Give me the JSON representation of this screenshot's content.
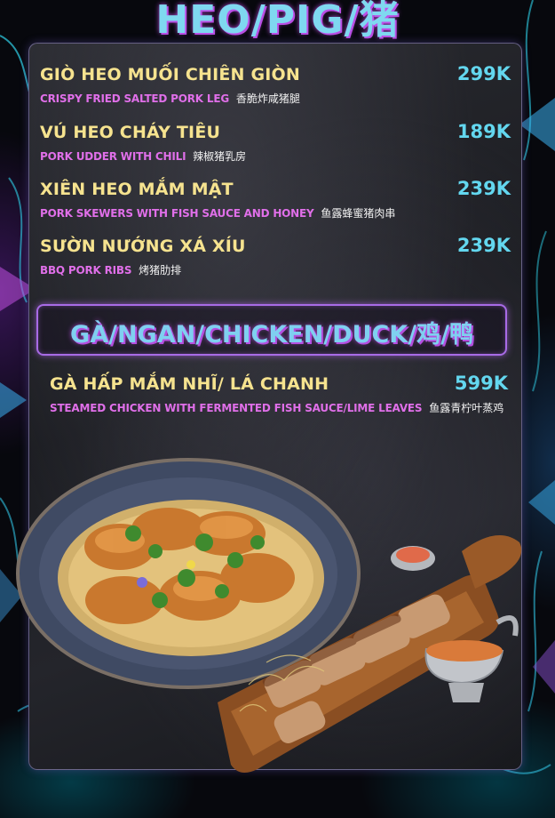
{
  "header": {
    "title": "HEO/PIG/猪"
  },
  "pork_items": [
    {
      "name": "GIÒ HEO MUỐI CHIÊN GIÒN",
      "price": "299K",
      "desc_en": "CRISPY FRIED SALTED PORK LEG",
      "desc_zh": "香脆炸咸猪腿"
    },
    {
      "name": "VÚ HEO CHÁY TIÊU",
      "price": "189K",
      "desc_en": "PORK UDDER WITH CHILI",
      "desc_zh": "辣椒猪乳房"
    },
    {
      "name": "XIÊN HEO MẮM MẬT",
      "price": "239K",
      "desc_en": "PORK SKEWERS WITH FISH SAUCE AND HONEY",
      "desc_zh": "鱼露蜂蜜猪肉串"
    },
    {
      "name": "SƯỜN NƯỚNG XÁ XÍU",
      "price": "239K",
      "desc_en": "BBQ PORK RIBS",
      "desc_zh": "烤猪肋排"
    }
  ],
  "section": {
    "title": "GÀ/NGAN/CHICKEN/DUCK/鸡/鸭"
  },
  "chicken_items": [
    {
      "name": "GÀ HẤP MẮM NHĨ/ LÁ CHANH",
      "price": "599K",
      "desc_en": "STEAMED CHICKEN WITH FERMENTED FISH SAUCE/LIME LEAVES",
      "desc_zh": "鱼露青柠叶蒸鸡"
    }
  ],
  "colors": {
    "item_name": "#f6e38f",
    "price": "#63d7ef",
    "desc_en": "#e06fe9",
    "accent_border": "#a86be6"
  }
}
